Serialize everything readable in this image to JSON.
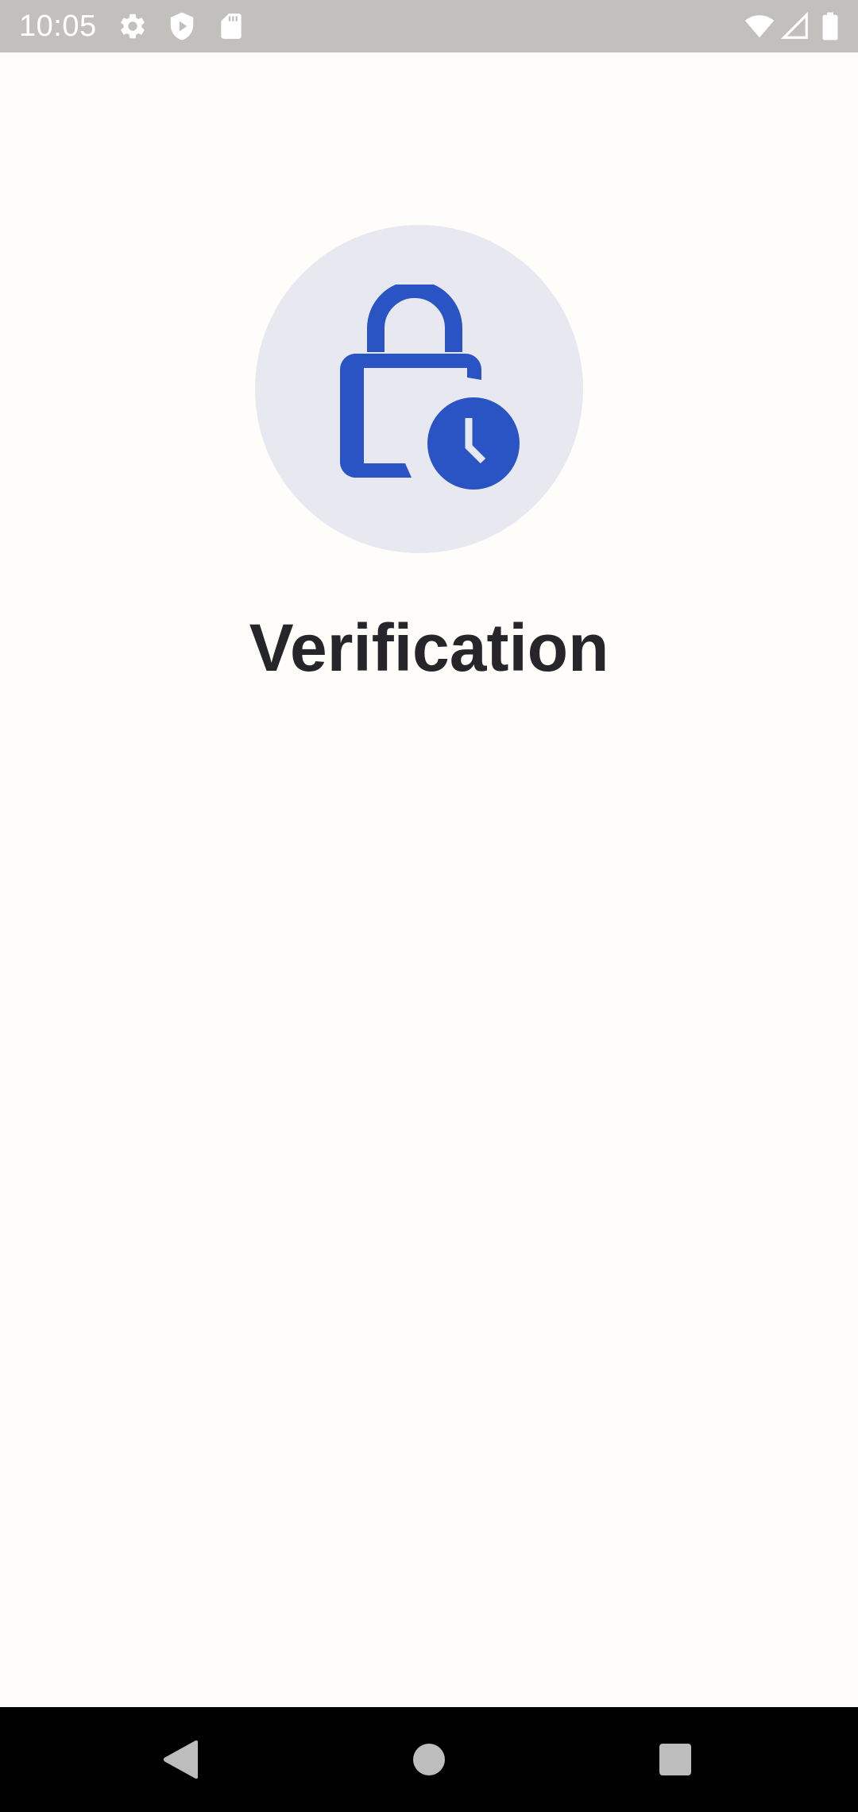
{
  "status_bar": {
    "time": "10:05",
    "left_icons": [
      "gear-icon",
      "shield-play-icon",
      "sd-card-icon"
    ],
    "right_icons": [
      "wifi-icon",
      "signal-icon",
      "battery-icon"
    ]
  },
  "main": {
    "hero_icon": "lock-clock-icon",
    "title": "Verification"
  },
  "nav_bar": {
    "buttons": [
      "back-icon",
      "home-icon",
      "recents-icon"
    ]
  },
  "colors": {
    "accent": "#2A54C4",
    "hero_circle": "#E8E8F1",
    "background": "#FEFDF9",
    "title_text": "#26262A",
    "status_bar": "#C1C0BC"
  }
}
